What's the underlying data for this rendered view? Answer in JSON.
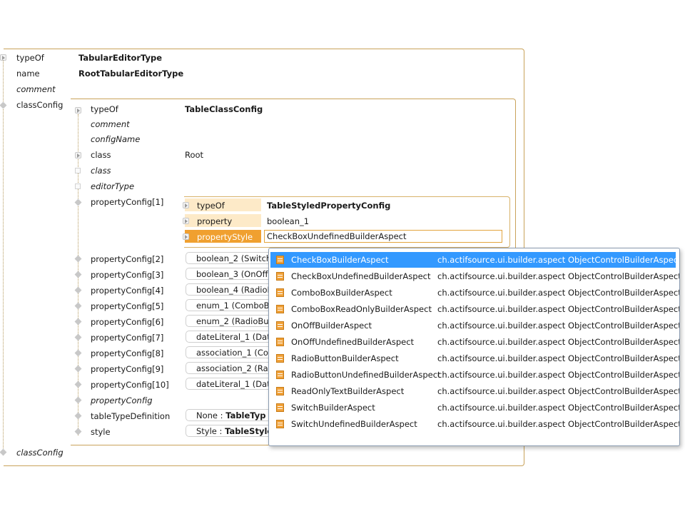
{
  "root": {
    "rows": [
      {
        "label": "typeOf",
        "value": "TabularEditorType"
      },
      {
        "label": "name",
        "value": "RootTabularEditorType"
      },
      {
        "label": "comment",
        "value": ""
      },
      {
        "label": "classConfig",
        "value": ""
      }
    ],
    "footer_label": "classConfig"
  },
  "class_config": {
    "rows": [
      {
        "label": "typeOf",
        "value": "TableClassConfig"
      },
      {
        "label": "comment",
        "value": ""
      },
      {
        "label": "configName",
        "value": ""
      },
      {
        "label": "class",
        "value": "Root"
      },
      {
        "label": "class",
        "value": ""
      },
      {
        "label": "editorType",
        "value": ""
      },
      {
        "label": "propertyConfig[1]",
        "value": ""
      }
    ],
    "property_config_1": {
      "typeOf_label": "typeOf",
      "typeOf_value": "TableStyledPropertyConfig",
      "property_label": "property",
      "property_value": "boolean_1",
      "propertyStyle_label": "propertyStyle",
      "propertyStyle_value": "CheckBoxUndefinedBuilderAspect"
    },
    "list_rows": [
      {
        "label": "propertyConfig[2]",
        "value": "boolean_2 (Switch"
      },
      {
        "label": "propertyConfig[3]",
        "value": "boolean_3 (OnOff"
      },
      {
        "label": "propertyConfig[4]",
        "value": "boolean_4 (RadioB"
      },
      {
        "label": "propertyConfig[5]",
        "value": "enum_1 (ComboB"
      },
      {
        "label": "propertyConfig[6]",
        "value": "enum_2 (RadioBut"
      },
      {
        "label": "propertyConfig[7]",
        "value": "dateLiteral_1 (Date"
      },
      {
        "label": "propertyConfig[8]",
        "value": "association_1 (Cor"
      },
      {
        "label": "propertyConfig[9]",
        "value": "association_2 (Rad"
      },
      {
        "label": "propertyConfig[10]",
        "value": "dateLiteral_1 (Dat"
      },
      {
        "label": "propertyConfig",
        "value": ""
      },
      {
        "label": "tableTypeDefinition",
        "value_prefix": "None : ",
        "value": "TableTyp"
      },
      {
        "label": "style",
        "value_prefix": "Style : ",
        "value": "TableStyle"
      }
    ]
  },
  "popup": {
    "items": [
      {
        "name": "CheckBoxBuilderAspect",
        "package": "ch.actifsource.ui.builder.aspect ObjectControlBuilderAspect",
        "selected": true
      },
      {
        "name": "CheckBoxUndefinedBuilderAspect",
        "package": "ch.actifsource.ui.builder.aspect ObjectControlBuilderAspect"
      },
      {
        "name": "ComboBoxBuilderAspect",
        "package": "ch.actifsource.ui.builder.aspect ObjectControlBuilderAspect"
      },
      {
        "name": "ComboBoxReadOnlyBuilderAspect",
        "package": "ch.actifsource.ui.builder.aspect ObjectControlBuilderAspect"
      },
      {
        "name": "OnOffBuilderAspect",
        "package": "ch.actifsource.ui.builder.aspect ObjectControlBuilderAspect"
      },
      {
        "name": "OnOffUndefinedBuilderAspect",
        "package": "ch.actifsource.ui.builder.aspect ObjectControlBuilderAspect"
      },
      {
        "name": "RadioButtonBuilderAspect",
        "package": "ch.actifsource.ui.builder.aspect ObjectControlBuilderAspect"
      },
      {
        "name": "RadioButtonUndefinedBuilderAspect",
        "package": "ch.actifsource.ui.builder.aspect ObjectControlBuilderAspect"
      },
      {
        "name": "ReadOnlyTextBuilderAspect",
        "package": "ch.actifsource.ui.builder.aspect ObjectControlBuilderAspect"
      },
      {
        "name": "SwitchBuilderAspect",
        "package": "ch.actifsource.ui.builder.aspect ObjectControlBuilderAspect"
      },
      {
        "name": "SwitchUndefinedBuilderAspect",
        "package": "ch.actifsource.ui.builder.aspect ObjectControlBuilderAspect"
      }
    ]
  },
  "colors": {
    "frame": "#c9a25a",
    "highlight_bg": "#fdeac8",
    "selected_style_bg": "#f0a030",
    "selection": "#3399ff",
    "builder_icon": "#f1a23a"
  },
  "icons": {
    "expand": "expand-triangle-icon",
    "reference": "diamond-reference-icon",
    "empty": "empty-square-icon",
    "builder": "builder-aspect-icon"
  }
}
